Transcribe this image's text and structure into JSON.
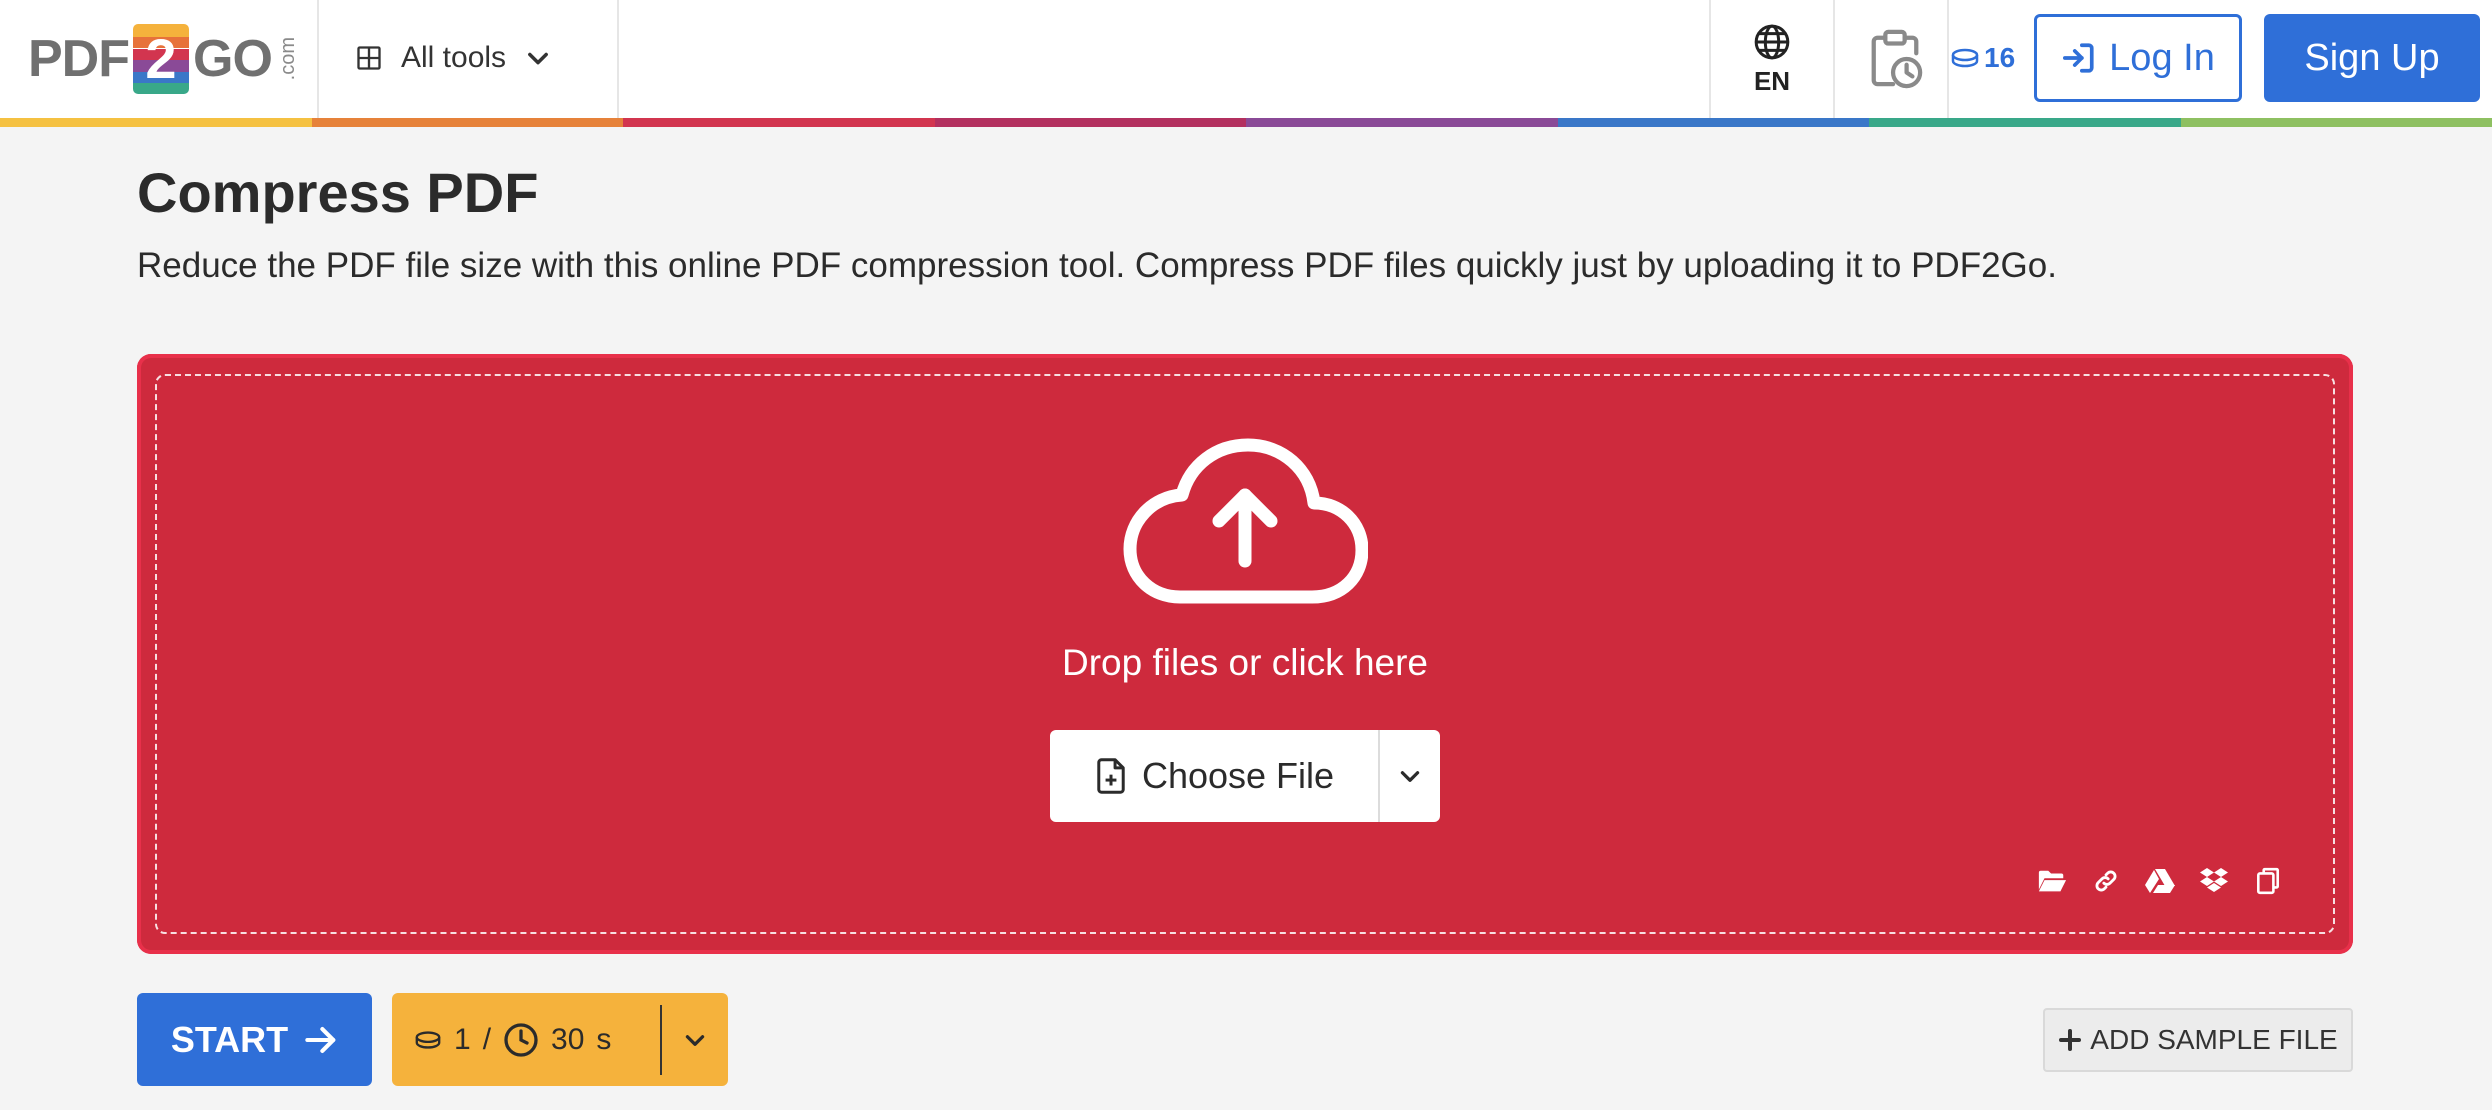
{
  "header": {
    "logo": {
      "left": "PDF",
      "middle": "2",
      "right": "GO",
      "suffix": ".com",
      "stripe_colors": [
        "#f5b23c",
        "#e7723a",
        "#d2354f",
        "#8a4a97",
        "#3a77c8",
        "#39a889"
      ]
    },
    "all_tools_label": "All tools",
    "language_code": "EN",
    "credits_count": "16",
    "login_label": "Log In",
    "signup_label": "Sign Up",
    "colorbar": [
      "#f5c141",
      "#e6823a",
      "#d2354f",
      "#b3305f",
      "#8a4a97",
      "#3a77c8",
      "#39a889",
      "#8ec061"
    ]
  },
  "main": {
    "title": "Compress PDF",
    "subtitle": "Reduce the PDF file size with this online PDF compression tool. Compress PDF files quickly just by uploading it to PDF2Go.",
    "dropzone": {
      "prompt": "Drop files or click here",
      "choose_label": "Choose File",
      "sources": [
        "folder-icon",
        "link-icon",
        "google-drive-icon",
        "dropbox-icon",
        "clipboard-icon"
      ]
    }
  },
  "actions": {
    "start_label": "START",
    "cost_credits": "1",
    "cost_separator": "/",
    "cost_time": "30",
    "cost_time_unit": "s",
    "add_sample_label": "ADD SAMPLE FILE"
  },
  "colors": {
    "primary": "#2f6fd8",
    "dropzone": "#ce2a3d",
    "cost": "#f5b23c"
  }
}
